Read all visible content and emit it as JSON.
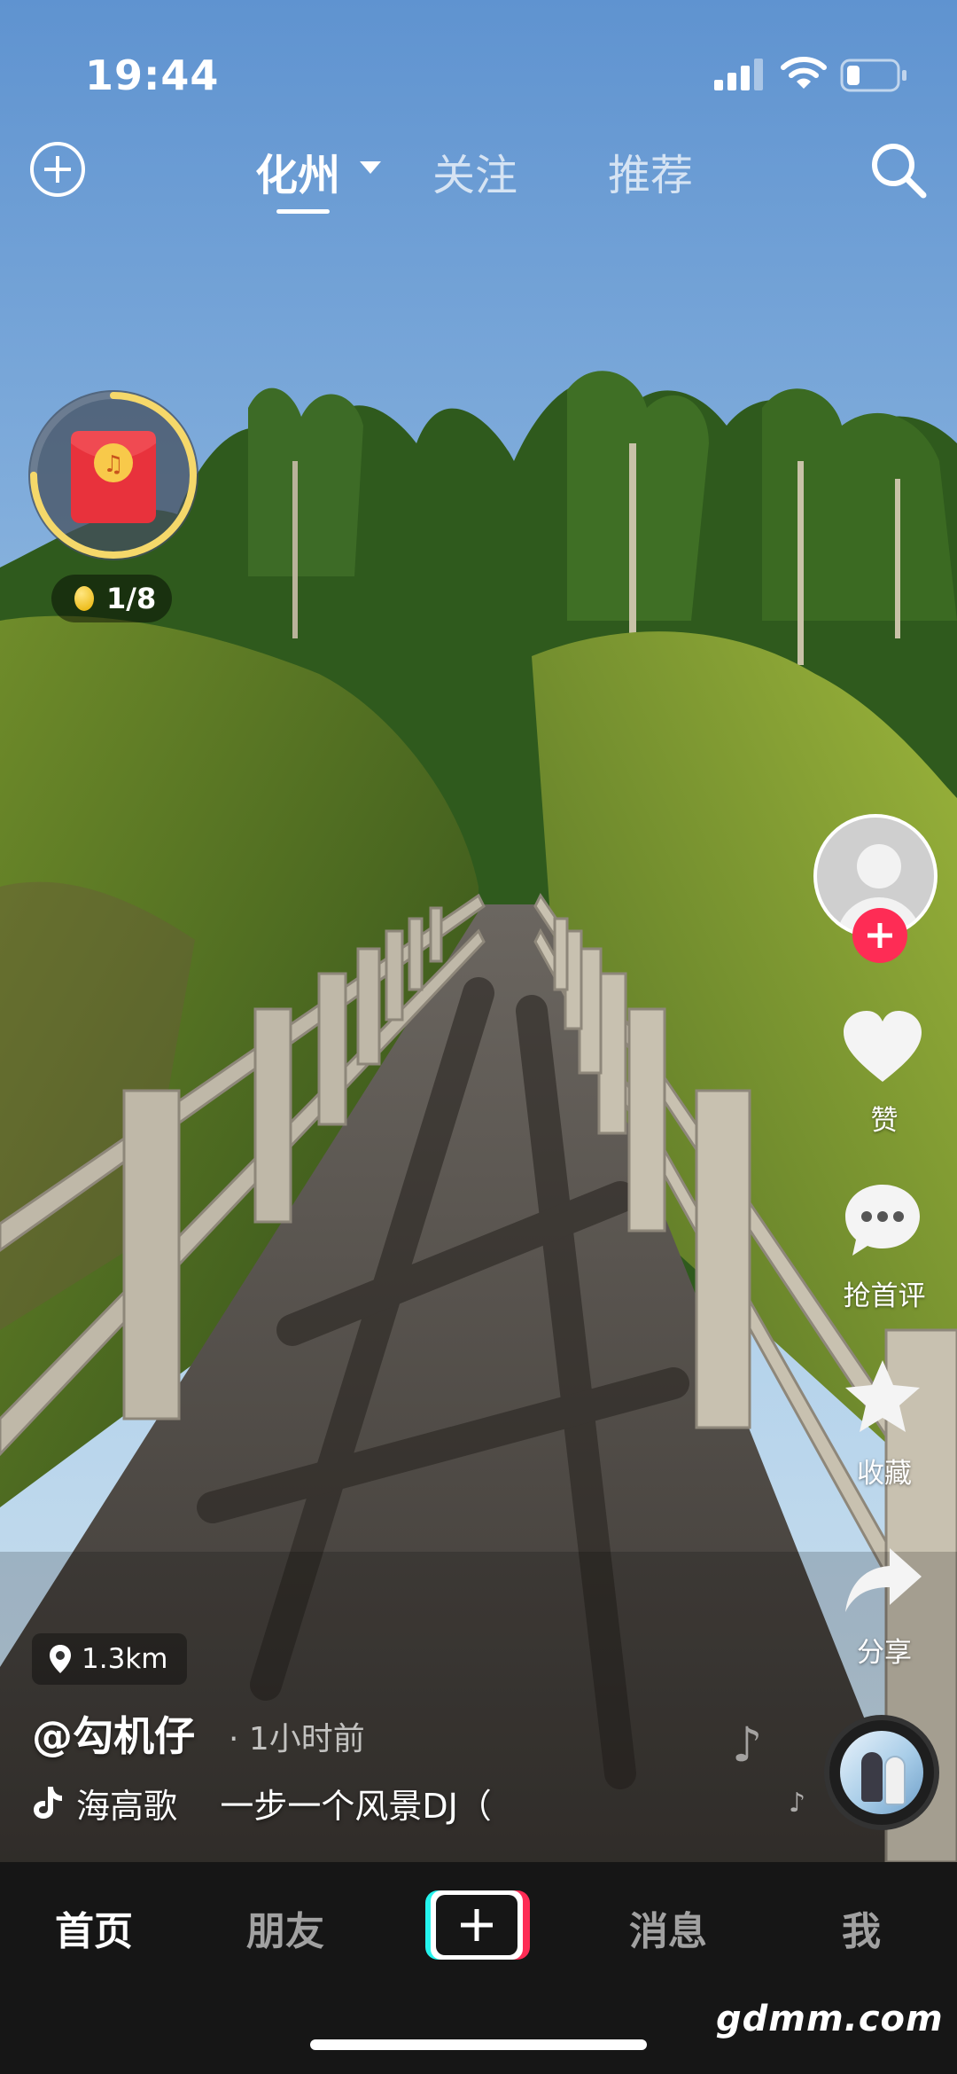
{
  "status_bar": {
    "time": "19:44"
  },
  "top_nav": {
    "tabs": [
      {
        "label": "化州"
      },
      {
        "label": "关注"
      },
      {
        "label": "推荐"
      }
    ]
  },
  "reward_widget": {
    "progress_text": "1/8",
    "ring_progress": 0.75
  },
  "side_rail": {
    "like_label": "赞",
    "comment_label": "抢首评",
    "favorite_label": "收藏",
    "share_label": "分享"
  },
  "post": {
    "location": "1.3km",
    "author": "@勾机仔",
    "time_ago": "· 1小时前",
    "music": "海高歌    一步一个风景DJ（"
  },
  "bottom_bar": {
    "home": "首页",
    "friends": "朋友",
    "messages": "消息",
    "me": "我"
  },
  "watermark": "gdmm.com",
  "colors": {
    "accent_red": "#fe2c55",
    "accent_cyan": "#25f4ee",
    "ring_yellow": "#f5d86a"
  }
}
